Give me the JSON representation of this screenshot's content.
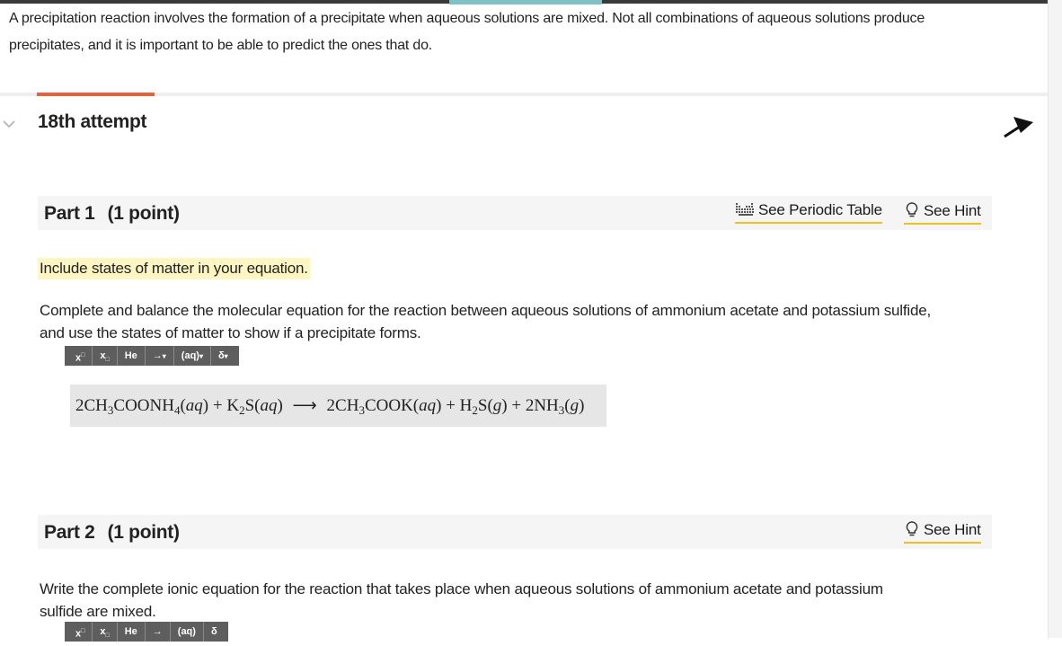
{
  "intro": {
    "line1": "A precipitation reaction involves the formation of a precipitate when aqueous solutions are mixed. Not all combinations of aqueous solutions produce",
    "line2": "precipitates, and it is important to be able to predict the ones that do."
  },
  "attempt": {
    "label": "18th attempt"
  },
  "part1": {
    "title": "Part 1",
    "points": "(1 point)",
    "periodic_link": "See Periodic Table",
    "hint_link": "See Hint",
    "note": "Include states of matter in your equation.",
    "question_line1": "Complete and balance the molecular equation for the reaction between aqueous solutions of ammonium acetate and potassium sulfide,",
    "question_line2": "and use the states of matter to show if a precipitate forms.",
    "answer": {
      "t1": "2CH",
      "s1": "3",
      "t2": "COONH",
      "s2": "4",
      "t3": "(",
      "st1": "aq",
      "t4": ") + K",
      "s3": "2",
      "t5": "S(",
      "st2": "aq",
      "t6": ")",
      "arrow": "⟶",
      "t7": "2CH",
      "s4": "3",
      "t8": "COOK(",
      "st3": "aq",
      "t9": ") + H",
      "s5": "2",
      "t10": "S(",
      "st4": "g",
      "t11": ") + 2NH",
      "s6": "3",
      "t12": "(",
      "st5": "g",
      "t13": ")"
    }
  },
  "part2": {
    "title": "Part 2",
    "points": "(1 point)",
    "hint_link": "See Hint",
    "question_line1": "Write the complete ionic equation for the reaction that takes place when aqueous solutions of ammonium acetate and potassium",
    "question_line2": "sulfide are mixed."
  },
  "toolbar": {
    "superscript": "x",
    "subscript": "x",
    "element": "He",
    "arrow": "→",
    "state": "(aq)",
    "delta": "δ"
  }
}
